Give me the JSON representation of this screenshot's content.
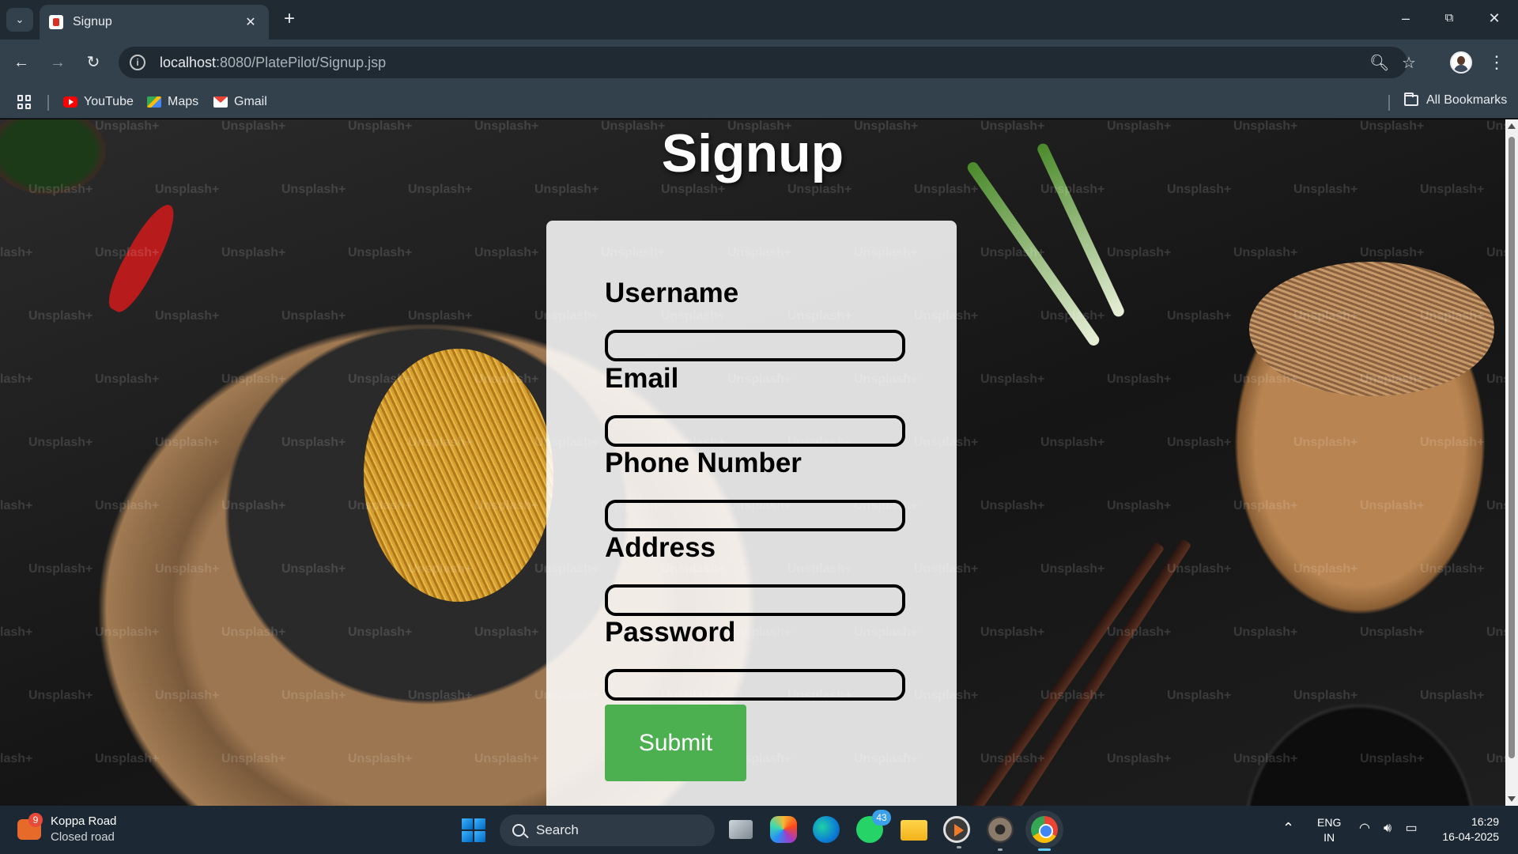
{
  "browser": {
    "tab_title": "Signup",
    "url_host": "localhost",
    "url_path": ":8080/PlatePilot/Signup.jsp",
    "bookmarks": [
      {
        "label": "YouTube",
        "icon": "youtube-icon"
      },
      {
        "label": "Maps",
        "icon": "maps-icon"
      },
      {
        "label": "Gmail",
        "icon": "gmail-icon"
      }
    ],
    "all_bookmarks_label": "All Bookmarks"
  },
  "page": {
    "title": "Signup",
    "watermark": "Unsplash+",
    "form": {
      "fields": [
        {
          "label": "Username",
          "value": "",
          "name": "username"
        },
        {
          "label": "Email",
          "value": "",
          "name": "email"
        },
        {
          "label": "Phone Number",
          "value": "",
          "name": "phone"
        },
        {
          "label": "Address",
          "value": "",
          "name": "address"
        },
        {
          "label": "Password",
          "value": "",
          "name": "password"
        }
      ],
      "submit_label": "Submit"
    },
    "colors": {
      "submit": "#4caf50",
      "card": "rgba(255,255,255,0.86)"
    }
  },
  "taskbar": {
    "weather": {
      "title": "Koppa Road",
      "subtitle": "Closed road",
      "badge": "9"
    },
    "search_label": "Search",
    "whatsapp_badge": "43",
    "language": {
      "line1": "ENG",
      "line2": "IN"
    },
    "clock": {
      "time": "16:29",
      "date": "16-04-2025"
    }
  }
}
